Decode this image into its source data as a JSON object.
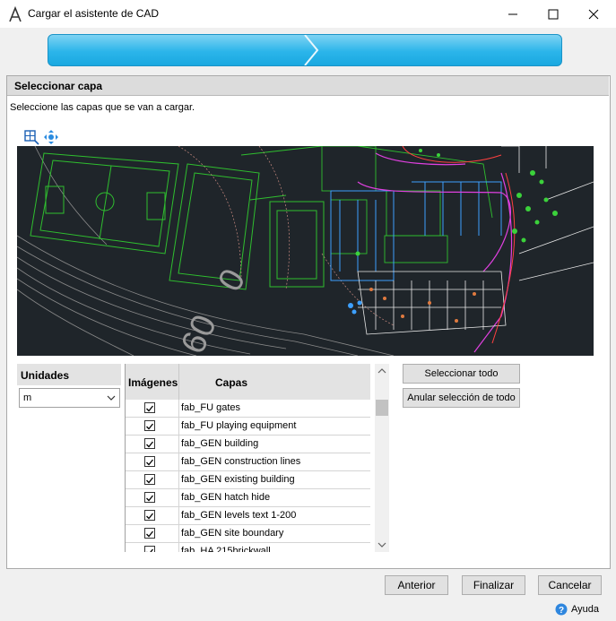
{
  "window": {
    "title": "Cargar el asistente de CAD",
    "minimize_icon": "minimize-icon",
    "maximize_icon": "maximize-icon",
    "close_icon": "close-icon"
  },
  "step": {
    "header": "Seleccionar capa",
    "instructions": "Seleccione las capas que se van a cargar."
  },
  "toolbar": {
    "icons": [
      "zoom-extents-icon",
      "pan-icon"
    ]
  },
  "units": {
    "header": "Unidades",
    "selected": "m"
  },
  "layers": {
    "col_images": "Imágenes",
    "col_layers": "Capas",
    "rows": [
      {
        "name": "fab_FU gates",
        "checked": true
      },
      {
        "name": "fab_FU playing equipment",
        "checked": true
      },
      {
        "name": "fab_GEN building",
        "checked": true
      },
      {
        "name": "fab_GEN construction lines",
        "checked": true
      },
      {
        "name": "fab_GEN existing building",
        "checked": true
      },
      {
        "name": "fab_GEN hatch hide",
        "checked": true
      },
      {
        "name": "fab_GEN levels text 1-200",
        "checked": true
      },
      {
        "name": "fab_GEN site boundary",
        "checked": true
      },
      {
        "name": "fab_HA 215brickwall",
        "checked": true
      }
    ]
  },
  "actions": {
    "select_all": "Seleccionar todo",
    "deselect_all": "Anular selección de todo"
  },
  "footer": {
    "back": "Anterior",
    "finish": "Finalizar",
    "cancel": "Cancelar",
    "help": "Ayuda"
  },
  "colors": {
    "progress": "#2bb5ea",
    "preview_bg": "#1f252a"
  }
}
